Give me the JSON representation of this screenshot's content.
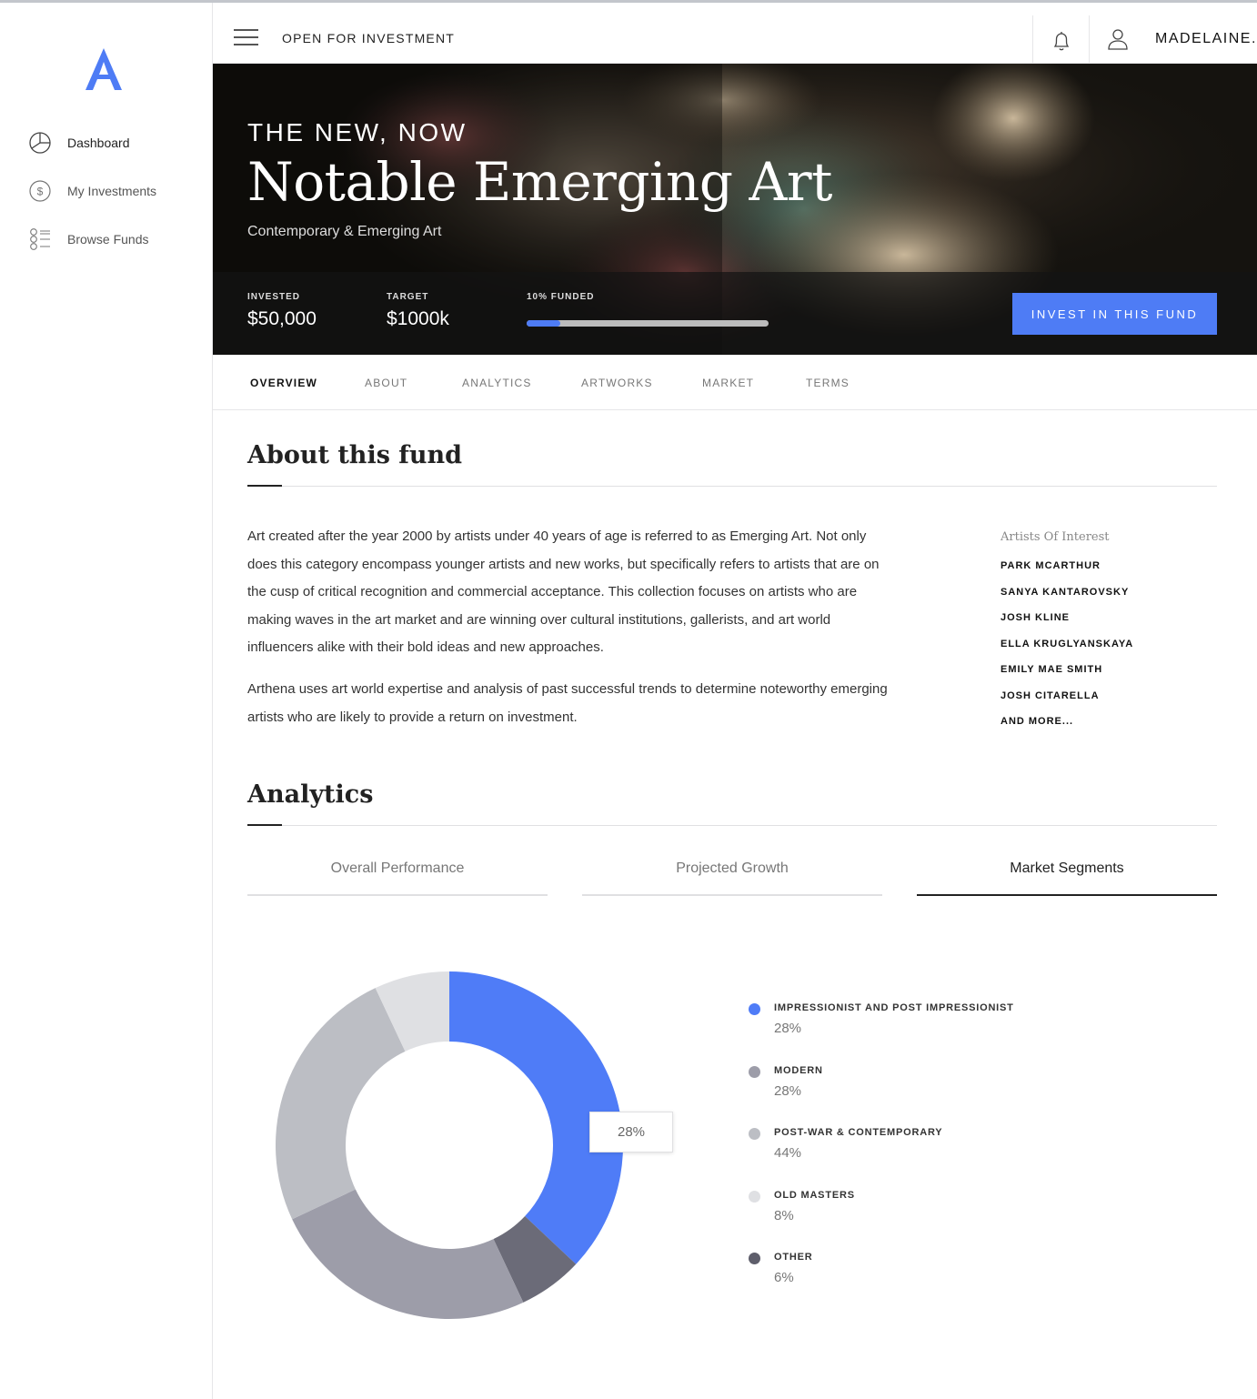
{
  "header": {
    "title": "OPEN FOR INVESTMENT",
    "username": "MADELAINE."
  },
  "sidebar": {
    "items": [
      {
        "label": "Dashboard",
        "icon": "pie-chart-icon"
      },
      {
        "label": "My Investments",
        "icon": "dollar-circle-icon"
      },
      {
        "label": "Browse Funds",
        "icon": "list-icon"
      }
    ]
  },
  "hero": {
    "eyebrow": "THE NEW, NOW",
    "title": "Notable Emerging Art",
    "subtitle": "Contemporary & Emerging Art",
    "invested_label": "INVESTED",
    "invested_value": "$50,000",
    "target_label": "TARGET",
    "target_value": "$1000k",
    "funded_label": "10% FUNDED",
    "funded_fraction": 0.14,
    "invest_button": "INVEST IN THIS FUND"
  },
  "tabs": [
    "OVERVIEW",
    "ABOUT",
    "ANALYTICS",
    "ARTWORKS",
    "MARKET",
    "TERMS"
  ],
  "about": {
    "title": "About this fund",
    "paragraphs": [
      "Art created after the year 2000 by artists under 40 years of age is referred to as Emerging Art. Not only does this category encompass younger artists and new works, but specifically refers to artists that are on the cusp of critical recognition and commercial acceptance. This collection focuses on artists who are making waves in the art market and are winning over cultural institutions, gallerists, and art world influencers alike with their bold ideas and new approaches.",
      "Arthena uses art world expertise and analysis of past successful trends to determine noteworthy emerging artists who are likely to provide a return on investment."
    ],
    "artists_title": "Artists Of Interest",
    "artists": [
      "PARK MCARTHUR",
      "SANYA KANTAROVSKY",
      "JOSH KLINE",
      "ELLA KRUGLYANSKAYA",
      "EMILY MAE SMITH",
      "JOSH CITARELLA",
      "AND MORE..."
    ]
  },
  "analytics": {
    "title": "Analytics",
    "tabs": [
      "Overall Performance",
      "Projected Growth",
      "Market Segments"
    ],
    "active_tab": 2,
    "tooltip": "28%"
  },
  "chart_data": {
    "type": "pie",
    "donut": true,
    "categories": [
      "IMPRESSIONIST AND POST IMPRESSIONIST",
      "OTHER",
      "MODERN",
      "POST-WAR & CONTEMPORARY",
      "OLD MASTERS"
    ],
    "values": [
      37,
      6,
      25,
      25,
      7
    ],
    "colors": [
      "#4f7cf7",
      "#6b6b78",
      "#9d9da9",
      "#bcbec4",
      "#dfe0e3"
    ],
    "legend": [
      {
        "name": "IMPRESSIONIST AND POST IMPRESSIONIST",
        "pct": "28%",
        "color": "#4f7cf7"
      },
      {
        "name": "MODERN",
        "pct": "28%",
        "color": "#9d9da9"
      },
      {
        "name": "POST-WAR & CONTEMPORARY",
        "pct": "44%",
        "color": "#bcbec4"
      },
      {
        "name": "OLD MASTERS",
        "pct": "8%",
        "color": "#dfe0e3"
      },
      {
        "name": "OTHER",
        "pct": "6%",
        "color": "#5e5e6b"
      }
    ],
    "legend_position": "right"
  },
  "colors": {
    "accent": "#4e7cf5"
  }
}
